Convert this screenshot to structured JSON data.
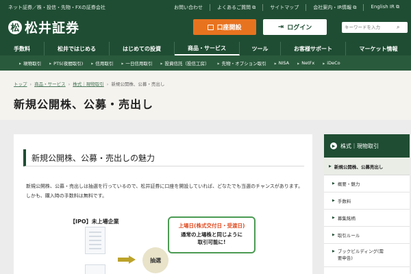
{
  "header": {
    "tagline": "ネット証券／株・投信・先物・FXの証券会社",
    "util_links": [
      "お問い合わせ",
      "よくあるご質問 ⧉",
      "サイトマップ",
      "会社案内・IR情報 ⧉",
      "English IR ⧉"
    ],
    "logo_text": "松井証券",
    "logo_mark": "松",
    "open_account_label": "口座開設",
    "login_label": "ログイン",
    "search_placeholder": "キーワードを入力"
  },
  "gnav": [
    "手数料",
    "松井ではじめる",
    "はじめての投資",
    "商品・サービス",
    "ツール",
    "お客様サポート",
    "マーケット情報"
  ],
  "subnav": [
    "現物取引",
    "PTS(夜間取引)",
    "信用取引",
    "一日信用取引",
    "投資信託（投信工房）",
    "先物・オプション取引",
    "NISA",
    "NetFx",
    "iDeCo"
  ],
  "breadcrumb": {
    "links": [
      "トップ",
      "商品・サービス",
      "株式｜現物取引"
    ],
    "current": "新規公開株、公募・売出し"
  },
  "page_title": "新規公開株、公募・売出し",
  "main": {
    "section_title": "新規公開株、公募・売出しの魅力",
    "paragraph": "新規公開株、公募・売出しは抽選を行っているので、松井証券に口座を開設していれば、どなたでも当選のチャンスがあります。しかも、購入時の手数料は無料です。",
    "diagram": {
      "ipo_label": "【IPO】未上場企業",
      "lottery": "抽選",
      "listing_head": "上場日(株式交付日・受渡日)",
      "listing_body_1": "通常の上場株と同じように",
      "listing_body_2": "取引可能に!"
    }
  },
  "side_nav": {
    "head": "株式｜現物取引",
    "active": "新規公開株、公募売出し",
    "items": [
      "概要・魅力",
      "手数料",
      "募集銘柄",
      "取引ルール"
    ],
    "last_item_1": "ブックビルディング(需",
    "last_item_2": "要申告)"
  },
  "colors": {
    "brand_green": "#1f4d33",
    "accent_orange": "#e8731f",
    "highlight_red": "#e04a1f",
    "box_green": "#4a9a52"
  }
}
